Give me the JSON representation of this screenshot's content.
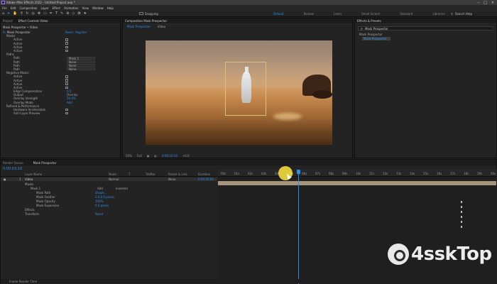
{
  "app": {
    "title": "Adobe After Effects 2022 - Untitled Project.aep *",
    "menu": [
      "File",
      "Edit",
      "Composition",
      "Layer",
      "Effect",
      "Animation",
      "View",
      "Window",
      "Help"
    ],
    "snapping": "Snapping",
    "workspaces": [
      "Default",
      "Review",
      "Learn",
      "Small Screen",
      "Standard",
      "Libraries"
    ],
    "workspace_active": "Default",
    "search_help": "Search Help"
  },
  "effect_controls": {
    "tabs": [
      "Project",
      "Effect Controls Video"
    ],
    "header": "Mask Prospector • Video",
    "effect_name": "Mask Prospector",
    "reset": "Reset",
    "about": "Register",
    "rows": [
      {
        "label": "Masks",
        "type": "section"
      },
      {
        "label": "Active",
        "type": "check"
      },
      {
        "label": "Active",
        "type": "check"
      },
      {
        "label": "Active",
        "type": "check"
      },
      {
        "label": "Active",
        "type": "check"
      },
      {
        "label": "Paths",
        "type": "section"
      },
      {
        "label": "Path",
        "type": "dropdown",
        "value": "Mask 1"
      },
      {
        "label": "Path",
        "type": "dropdown",
        "value": "None"
      },
      {
        "label": "Path",
        "type": "dropdown",
        "value": "None"
      },
      {
        "label": "Path",
        "type": "dropdown",
        "value": "None"
      },
      {
        "label": "Negative Masks",
        "type": "section"
      },
      {
        "label": "Active",
        "type": "check"
      },
      {
        "label": "Active",
        "type": "check"
      },
      {
        "label": "Active",
        "type": "check"
      },
      {
        "label": "Active",
        "type": "check"
      },
      {
        "label": "Edge Compensation",
        "type": "value",
        "value": "0.0"
      },
      {
        "label": "Output",
        "type": "value",
        "value": "Overlay",
        "plain": true
      },
      {
        "label": "Overlay Strength",
        "type": "value",
        "value": "50.0%"
      },
      {
        "label": "Overlay Mode",
        "type": "value",
        "value": "Add"
      },
      {
        "label": "Refined & Performance",
        "type": "section"
      },
      {
        "label": "Hardware Acceleration",
        "type": "check"
      },
      {
        "label": "Anti-Layer Preview",
        "type": "check"
      }
    ]
  },
  "composition": {
    "tab_label": "Composition Mask Prospector",
    "subtabs": [
      "Mask Prospector",
      "Video"
    ],
    "footer": [
      "50%",
      "Full",
      "0:00:03:16",
      "+0.0"
    ]
  },
  "effects_presets": {
    "title": "Effects & Presets",
    "search_value": "Mask Prospector",
    "tree": [
      "Mask Prospector"
    ],
    "selected": "Mask Prospector"
  },
  "timeline": {
    "tabs": [
      "Render Queue",
      "Mask Prospector"
    ],
    "timecode": "0:00:03:16",
    "columns": [
      "Layer Name",
      "Mode",
      "T",
      "TrkMat",
      "Parent & Link",
      "Duration"
    ],
    "layer": {
      "index": "1",
      "name": "Video",
      "mode": "Normal",
      "parent": "None",
      "duration": "0:00:05:00"
    },
    "rows": [
      {
        "label": "Masks",
        "indent": 1
      },
      {
        "label": "Mask 1",
        "indent": 2,
        "extra": "Add",
        "extra2": "Inverted"
      },
      {
        "label": "Mask Path",
        "indent": 3,
        "value": "Shape..."
      },
      {
        "label": "Mask Feather",
        "indent": 3,
        "value": "0.0,0.0 pixels"
      },
      {
        "label": "Mask Opacity",
        "indent": 3,
        "value": "100%"
      },
      {
        "label": "Mask Expansion",
        "indent": 3,
        "value": "0.0 pixels"
      },
      {
        "label": "Effects",
        "indent": 1
      },
      {
        "label": "Transform",
        "indent": 1,
        "value": "Reset"
      }
    ],
    "ruler": [
      "00s",
      "01s",
      "02s",
      "03s",
      "04s",
      "05s",
      "06s",
      "07s",
      "08s",
      "09s",
      "10s",
      "11s",
      "12s",
      "13s",
      "14s",
      "15s",
      "16s",
      "17s",
      "18s",
      "19s",
      "20s"
    ],
    "footer": "Frame Render Time"
  },
  "watermark": {
    "text": "4sskTop"
  }
}
